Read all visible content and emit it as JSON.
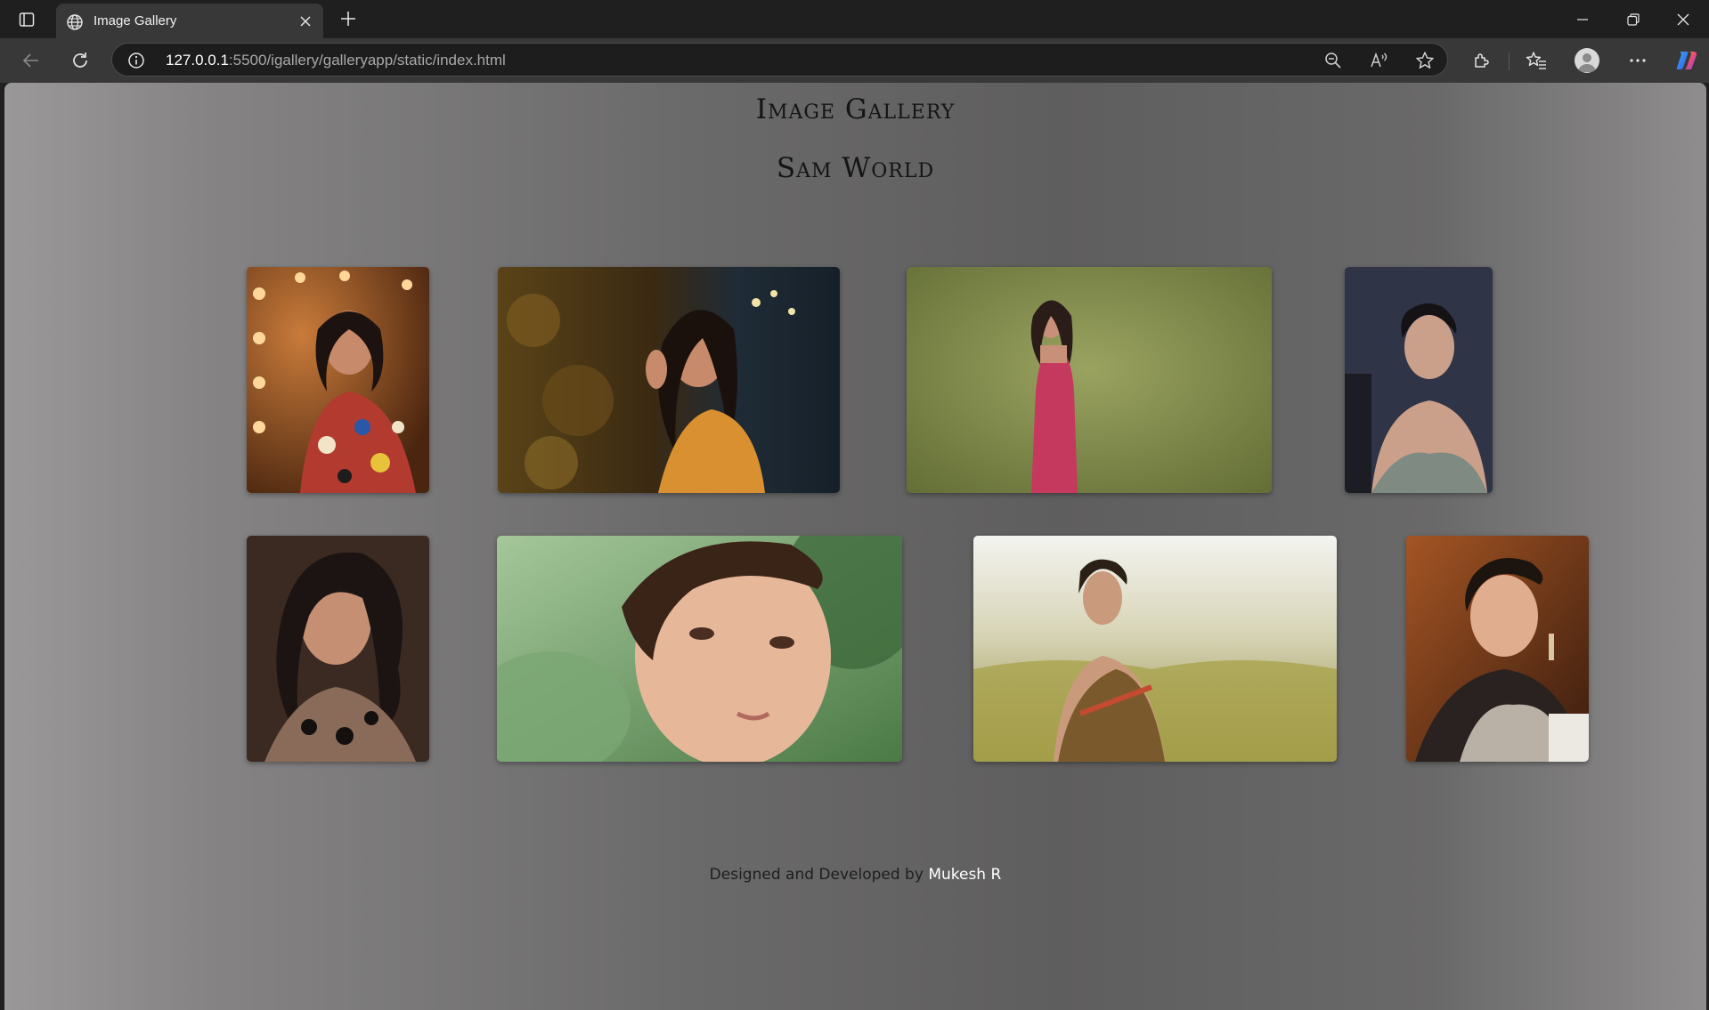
{
  "browser": {
    "tab": {
      "title": "Image Gallery",
      "favicon": "globe-icon"
    },
    "address": {
      "host": "127.0.0.1",
      "rest": ":5500/igallery/galleryapp/static/index.html"
    },
    "icons": [
      "tab-actions-icon",
      "globe-icon",
      "close-icon",
      "plus-icon",
      "minimize-icon",
      "restore-icon",
      "window-close-icon",
      "back-arrow-icon",
      "reload-icon",
      "info-icon",
      "zoom-out-icon",
      "read-aloud-icon",
      "star-icon",
      "extensions-icon",
      "favorites-icon",
      "profile-icon",
      "more-icon",
      "copilot-icon"
    ]
  },
  "page": {
    "title": "Image Gallery",
    "subtitle": "Sam World",
    "footer": {
      "prefix": "Designed and Developed by ",
      "author": "Mukesh R"
    },
    "photos": [
      {
        "name": "photo-1",
        "palette": [
          "#8a4a1c",
          "#e8b070",
          "#2b1d18",
          "#c73a30"
        ]
      },
      {
        "name": "photo-2",
        "palette": [
          "#5a4318",
          "#c9892e",
          "#1f2b36",
          "#e1a440"
        ]
      },
      {
        "name": "photo-3",
        "palette": [
          "#7d8a49",
          "#96a060",
          "#c5395f",
          "#2a1c18"
        ]
      },
      {
        "name": "photo-4",
        "palette": [
          "#2a2f3e",
          "#4b5064",
          "#c9a68e",
          "#1a1a1e"
        ]
      },
      {
        "name": "photo-5",
        "palette": [
          "#2a1d18",
          "#c58f74",
          "#5c4434",
          "#1a1412"
        ]
      },
      {
        "name": "photo-6",
        "palette": [
          "#8ab383",
          "#4b7a46",
          "#e7b79a",
          "#3a2418"
        ]
      },
      {
        "name": "photo-7",
        "palette": [
          "#f1f1ee",
          "#b8b36a",
          "#7a5a2c",
          "#2c2216"
        ]
      },
      {
        "name": "photo-8",
        "palette": [
          "#5a2c14",
          "#a45524",
          "#e6b89a",
          "#1e1a18"
        ]
      }
    ]
  }
}
